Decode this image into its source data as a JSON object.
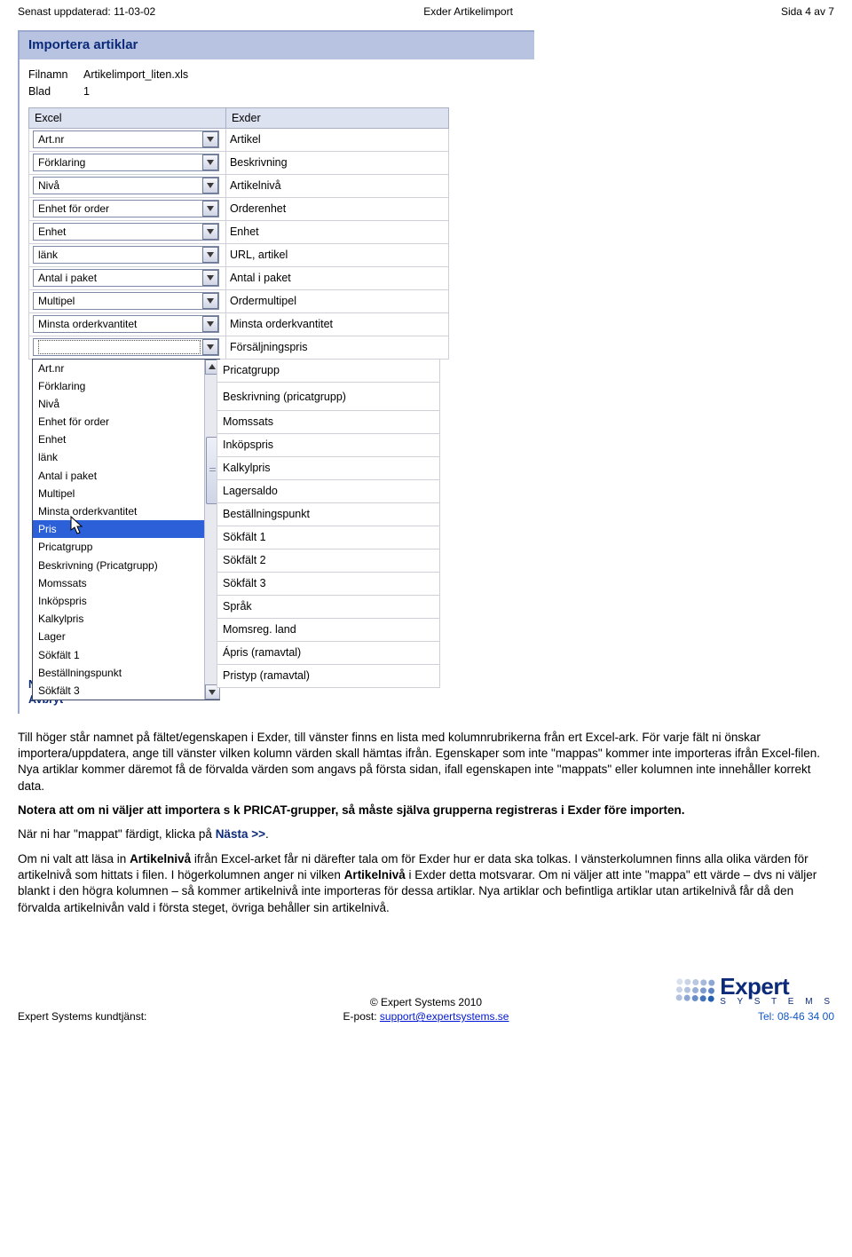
{
  "header": {
    "left": "Senast uppdaterad: 11-03-02",
    "center": "Exder Artikelimport",
    "right": "Sida 4 av 7"
  },
  "window": {
    "title": "Importera artiklar",
    "file_label": "Filnamn",
    "file_value": "Artikelimport_liten.xls",
    "sheet_label": "Blad",
    "sheet_value": "1",
    "col_excel": "Excel",
    "col_exder": "Exder",
    "rows": [
      {
        "excel": "Art.nr",
        "exder": "Artikel"
      },
      {
        "excel": "Förklaring",
        "exder": "Beskrivning"
      },
      {
        "excel": "Nivå",
        "exder": "Artikelnivå"
      },
      {
        "excel": "Enhet för order",
        "exder": "Orderenhet"
      },
      {
        "excel": "Enhet",
        "exder": "Enhet"
      },
      {
        "excel": "länk",
        "exder": "URL, artikel"
      },
      {
        "excel": "Antal i paket",
        "exder": "Antal i paket"
      },
      {
        "excel": "Multipel",
        "exder": "Ordermultipel"
      },
      {
        "excel": "Minsta orderkvantitet",
        "exder": "Minsta orderkvantitet"
      }
    ],
    "open_row_exder": "Försäljningspris",
    "dropdown_options": [
      "Art.nr",
      "Förklaring",
      "Nivå",
      "Enhet för order",
      "Enhet",
      "länk",
      "Antal i paket",
      "Multipel",
      "Minsta orderkvantitet",
      "Pris",
      "Pricatgrupp",
      "Beskrivning (Pricatgrupp)",
      "Momssats",
      "Inköpspris",
      "Kalkylpris",
      "Lager",
      "Sökfält 1",
      "Beställningspunkt",
      "Sökfält 3"
    ],
    "dropdown_selected_index": 9,
    "right_rows_under_dropdown": [
      "Pricatgrupp",
      "Beskrivning (pricatgrupp)",
      "Momssats",
      "Inköpspris",
      "Kalkylpris",
      "Lagersaldo",
      "Beställningspunkt",
      "Sökfält 1",
      "Sökfält 2",
      "Sökfält 3",
      "Språk",
      "Momsreg. land",
      "Ápris (ramavtal)",
      "Pristyp (ramavtal)"
    ],
    "next_label": "Nästa »",
    "cancel_label": "Avbryt"
  },
  "body": {
    "p1": "Till höger står namnet på fältet/egenskapen i Exder, till vänster finns en lista med kolumnrubrikerna från ert Excel-ark. För varje fält ni önskar importera/uppdatera, ange till vänster vilken kolumn värden skall hämtas ifrån. Egenskaper som inte \"mappas\" kommer inte importeras ifrån Excel-filen. Nya artiklar kommer däremot få de förvalda värden som angavs på första sidan, ifall egenskapen inte \"mappats\" eller kolumnen inte innehåller korrekt data.",
    "p2_prefix": "Notera att om ni väljer att importera s k PRICAT-grupper, så måste själva grupperna registreras i Exder före importen.",
    "p3_prefix": "När ni har \"mappat\" färdigt, klicka på ",
    "p3_link": "Nästa >>",
    "p3_suffix": ".",
    "p4": "Om ni valt att läsa in Artikelnivå ifrån Excel-arket får ni därefter tala om för Exder hur er data ska tolkas. I vänsterkolumnen finns alla olika värden för artikelnivå som hittats i filen. I högerkolumnen anger ni vilken Artikelnivå i Exder detta motsvarar. Om ni väljer att inte \"mappa\" ett värde – dvs ni väljer blankt i den högra kolumnen – så kommer artikelnivå inte importeras för dessa artiklar. Nya artiklar och befintliga artiklar utan artikelnivå får då den förvalda artikelnivån vald i första steget, övriga behåller sin artikelnivå."
  },
  "footer": {
    "copyright": "© Expert Systems 2010",
    "left_label": "Expert Systems kundtjänst:",
    "email_label": "E-post: ",
    "email": "support@expertsystems.se",
    "tel_label": "Tel: 08-46 34 00",
    "logo_text": "Expert",
    "logo_sub": "S Y S T E M S"
  }
}
